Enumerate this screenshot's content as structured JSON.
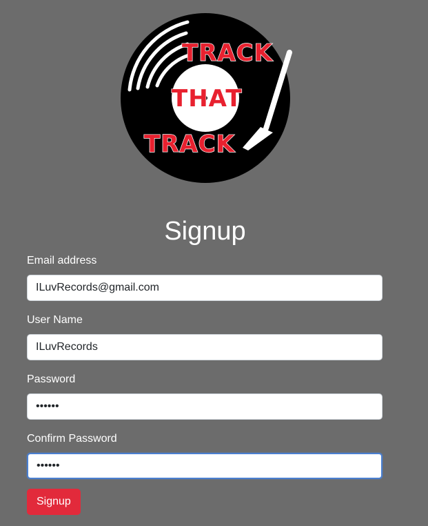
{
  "logo": {
    "line1": "TRACK",
    "line2": "THAT",
    "line3": "TRACK"
  },
  "page": {
    "title": "Signup"
  },
  "form": {
    "email": {
      "label": "Email address",
      "value": "ILuvRecords@gmail.com"
    },
    "username": {
      "label": "User Name",
      "value": "ILuvRecords"
    },
    "password": {
      "label": "Password",
      "value": "••••••"
    },
    "confirm_password": {
      "label": "Confirm Password",
      "value": "••••••"
    },
    "submit_label": "Signup"
  },
  "colors": {
    "background": "#6c6c6c",
    "accent": "#e22a3b",
    "focus": "#4a7fd0"
  },
  "icons": {
    "logo": "vinyl-record-logo-icon"
  }
}
